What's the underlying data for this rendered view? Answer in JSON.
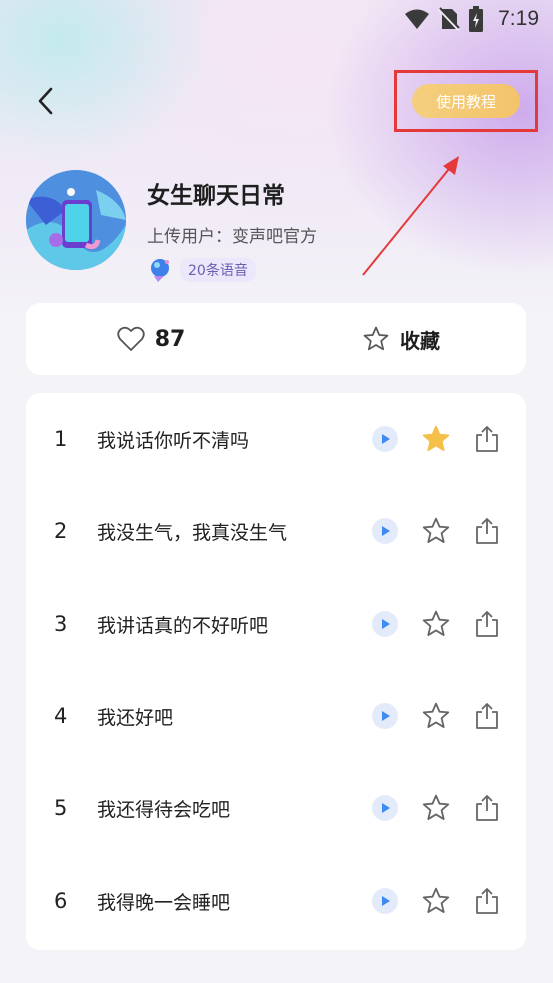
{
  "status_bar": {
    "time": "7:19"
  },
  "header": {
    "tutorial_label": "使用教程"
  },
  "album": {
    "title": "女生聊天日常",
    "uploader": "上传用户：变声吧官方",
    "voice_count": "20条语音"
  },
  "stats": {
    "likes": "87",
    "favorite_label": "收藏"
  },
  "list": [
    {
      "num": "1",
      "title": "我说话你听不清吗",
      "starred": true
    },
    {
      "num": "2",
      "title": "我没生气，我真没生气",
      "starred": false
    },
    {
      "num": "3",
      "title": "我讲话真的不好听吧",
      "starred": false
    },
    {
      "num": "4",
      "title": "我还好吧",
      "starred": false
    },
    {
      "num": "5",
      "title": "我还得待会吃吧",
      "starred": false
    },
    {
      "num": "6",
      "title": "我得晚一会睡吧",
      "starred": false
    }
  ],
  "colors": {
    "accent": "#f3c36a",
    "highlight_box": "#e53939",
    "star_active": "#f5c04a",
    "play_bg": "#e3ebfb",
    "play_icon": "#3d8bf0"
  },
  "icons": [
    "wifi-icon",
    "no-sim-icon",
    "battery-icon",
    "back-icon",
    "heart-icon",
    "star-icon",
    "play-icon",
    "share-icon",
    "mascot-icon"
  ]
}
